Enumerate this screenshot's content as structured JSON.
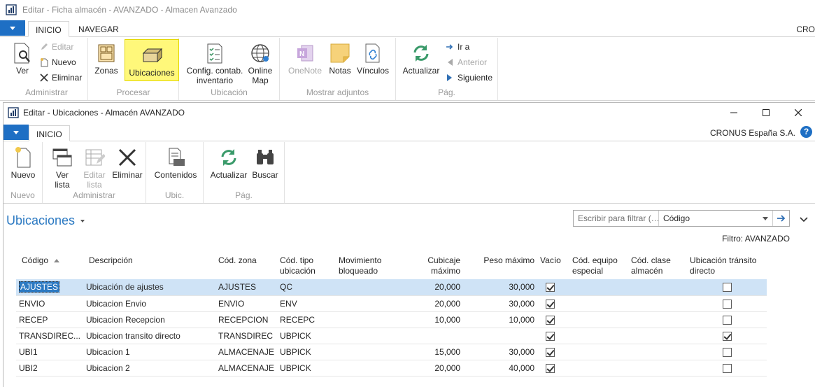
{
  "outer": {
    "title": "Editar - Ficha almacén - AVANZADO - Almacen Avanzado",
    "tabs": [
      "INICIO",
      "NAVEGAR"
    ],
    "company": "CRO",
    "groups": {
      "administrar": {
        "label": "Administrar",
        "ver": "Ver",
        "editar": "Editar",
        "nuevo": "Nuevo",
        "eliminar": "Eliminar"
      },
      "procesar": {
        "label": "Procesar",
        "zonas": "Zonas",
        "ubicaciones": "Ubicaciones"
      },
      "ubicacion": {
        "label": "Ubicación",
        "config_line1": "Config. contab.",
        "config_line2": "inventario",
        "online_line1": "Online",
        "online_line2": "Map"
      },
      "adjuntos": {
        "label": "Mostrar adjuntos",
        "onenote": "OneNote",
        "notas": "Notas",
        "vinculos": "Vínculos"
      },
      "pag": {
        "label": "Pág.",
        "actualizar": "Actualizar",
        "ira": "Ir a",
        "anterior": "Anterior",
        "siguiente": "Siguiente"
      }
    }
  },
  "inner": {
    "title": "Editar - Ubicaciones - Almacén AVANZADO",
    "tab": "INICIO",
    "company": "CRONUS España S.A.",
    "help": "?",
    "groups": {
      "nuevo": {
        "label": "Nuevo",
        "nuevo": "Nuevo"
      },
      "administrar": {
        "label": "Administrar",
        "ver_line1": "Ver",
        "ver_line2": "lista",
        "editar_line1": "Editar",
        "editar_line2": "lista",
        "eliminar": "Eliminar"
      },
      "ubic": {
        "label": "Ubic.",
        "contenidos": "Contenidos"
      },
      "pag": {
        "label": "Pág.",
        "actualizar": "Actualizar",
        "buscar": "Buscar"
      }
    },
    "page_title": "Ubicaciones",
    "filter": {
      "placeholder": "Escribir para filtrar (…",
      "field": "Código"
    },
    "filter_info": "Filtro: AVANZADO",
    "columns": {
      "codigo": "Código",
      "descripcion": "Descripción",
      "zona": "Cód. zona",
      "tipo_line1": "Cód. tipo",
      "tipo_line2": "ubicación",
      "mov_line1": "Movimiento",
      "mov_line2": "bloqueado",
      "cub_line1": "Cubicaje",
      "cub_line2": "máximo",
      "peso": "Peso máximo",
      "vacio": "Vacío",
      "equipo_line1": "Cód. equipo",
      "equipo_line2": "especial",
      "clase_line1": "Cód. clase",
      "clase_line2": "almacén",
      "transito_line1": "Ubicación tránsito",
      "transito_line2": "directo"
    },
    "rows": [
      {
        "codigo": "AJUSTES",
        "descripcion": "Ubicación de ajustes",
        "zona": "AJUSTES",
        "tipo": "QC",
        "mov": "",
        "cubicaje": "20,000",
        "peso": "30,000",
        "vacio": true,
        "equipo": "",
        "clase": "",
        "transito": false
      },
      {
        "codigo": "ENVIO",
        "descripcion": "Ubicacion Envio",
        "zona": "ENVIO",
        "tipo": "ENV",
        "mov": "",
        "cubicaje": "20,000",
        "peso": "30,000",
        "vacio": true,
        "equipo": "",
        "clase": "",
        "transito": false
      },
      {
        "codigo": "RECEP",
        "descripcion": "Ubicacion Recepcion",
        "zona": "RECEPCION",
        "tipo": "RECEPC",
        "mov": "",
        "cubicaje": "10,000",
        "peso": "10,000",
        "vacio": true,
        "equipo": "",
        "clase": "",
        "transito": false
      },
      {
        "codigo": "TRANSDIREC...",
        "descripcion": "Ubicacion transito directo",
        "zona": "TRANSDIREC",
        "tipo": "UBPICK",
        "mov": "",
        "cubicaje": "",
        "peso": "",
        "vacio": true,
        "equipo": "",
        "clase": "",
        "transito": true
      },
      {
        "codigo": "UBI1",
        "descripcion": "Ubicacion 1",
        "zona": "ALMACENAJE",
        "tipo": "UBPICK",
        "mov": "",
        "cubicaje": "15,000",
        "peso": "30,000",
        "vacio": true,
        "equipo": "",
        "clase": "",
        "transito": false
      },
      {
        "codigo": "UBI2",
        "descripcion": "Ubicacion 2",
        "zona": "ALMACENAJE",
        "tipo": "UBPICK",
        "mov": "",
        "cubicaje": "20,000",
        "peso": "40,000",
        "vacio": true,
        "equipo": "",
        "clase": "",
        "transito": false
      }
    ]
  }
}
